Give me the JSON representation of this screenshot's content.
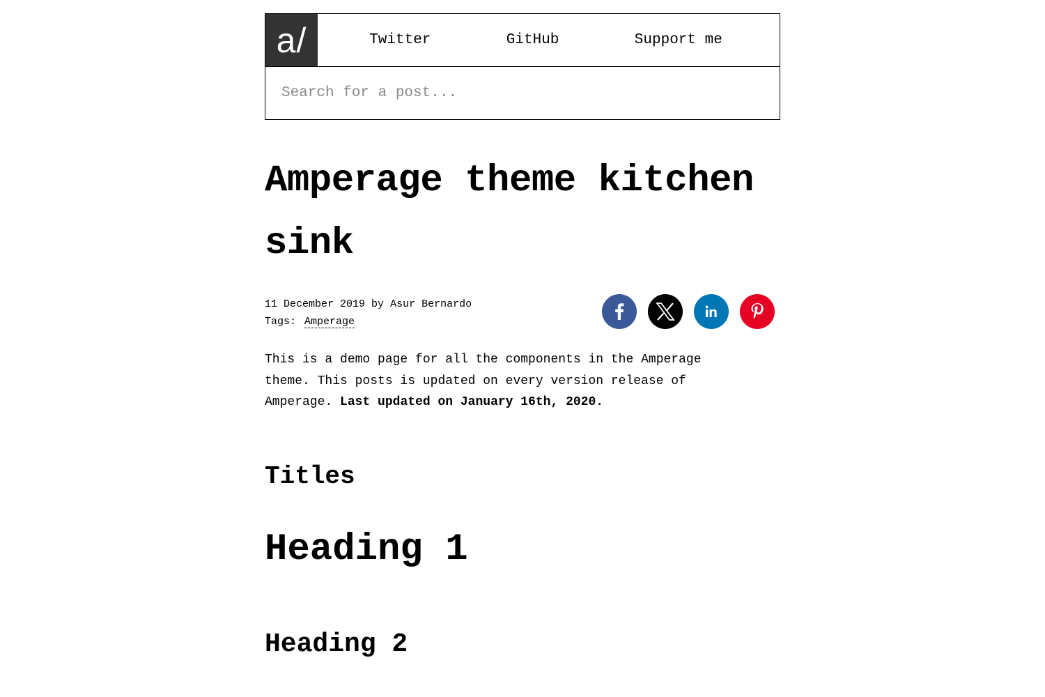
{
  "header": {
    "logo_text": "a/",
    "nav": [
      {
        "label": "Twitter"
      },
      {
        "label": "GitHub"
      },
      {
        "label": "Support me"
      }
    ],
    "search": {
      "placeholder": "Search for a post...",
      "value": ""
    }
  },
  "post": {
    "title": "Amperage theme kitchen sink",
    "date": "11 December 2019",
    "by_label": "by",
    "author": "Asur Bernardo",
    "tags_label": "Tags:",
    "tags": [
      "Amperage"
    ],
    "intro_text": "This is a demo page for all the components in the Amperage theme. This posts is updated on every version release of Amperage.",
    "intro_bold": "Last updated on January 16th, 2020.",
    "section_titles": "Titles",
    "heading1": "Heading 1",
    "heading2": "Heading 2"
  },
  "share": [
    {
      "name": "facebook",
      "icon": "facebook-icon",
      "color": "#3b5998"
    },
    {
      "name": "x",
      "icon": "x-icon",
      "color": "#000000"
    },
    {
      "name": "linkedin",
      "icon": "linkedin-icon",
      "color": "#0077b5"
    },
    {
      "name": "pinterest",
      "icon": "pinterest-icon",
      "color": "#e60023"
    }
  ]
}
